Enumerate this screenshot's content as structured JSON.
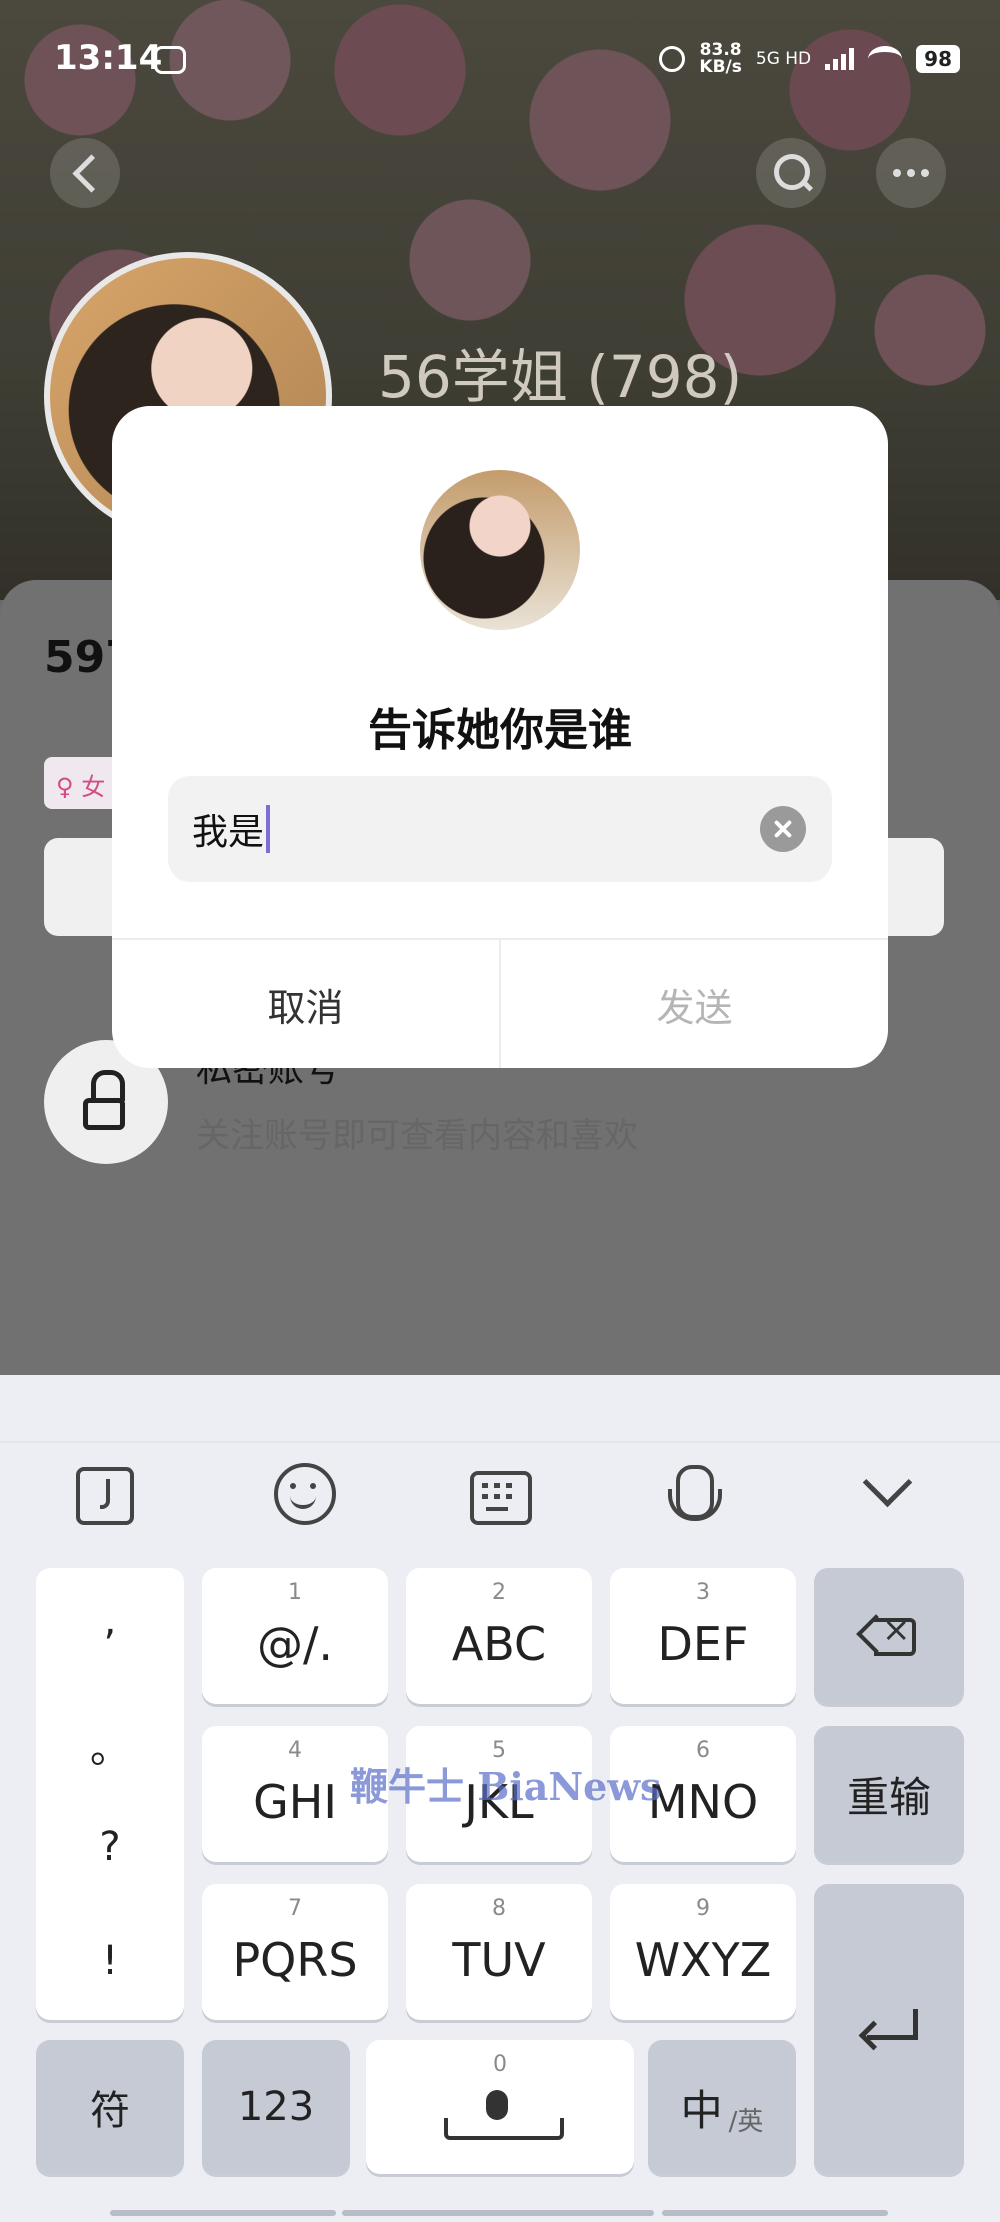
{
  "status_bar": {
    "time": "13:14",
    "net_speed_value": "83.8",
    "net_speed_unit": "KB/s",
    "network": "5G HD",
    "battery": "98"
  },
  "profile": {
    "name": "56学姐 (798)",
    "stat_partial": "597",
    "tag_partial": "♀ 女",
    "private_title": "私密账号",
    "private_subtitle": "关注账号即可查看内容和喜欢"
  },
  "dialog": {
    "title": "告诉她你是谁",
    "input_value": "我是",
    "cancel_label": "取消",
    "send_label": "发送"
  },
  "keyboard": {
    "punctuation": [
      ",",
      "。",
      "?",
      "!"
    ],
    "rows": [
      [
        {
          "num": "1",
          "label": "@/."
        },
        {
          "num": "2",
          "label": "ABC"
        },
        {
          "num": "3",
          "label": "DEF"
        }
      ],
      [
        {
          "num": "4",
          "label": "GHI"
        },
        {
          "num": "5",
          "label": "JKL"
        },
        {
          "num": "6",
          "label": "MNO"
        }
      ],
      [
        {
          "num": "7",
          "label": "PQRS"
        },
        {
          "num": "8",
          "label": "TUV"
        },
        {
          "num": "9",
          "label": "WXYZ"
        }
      ]
    ],
    "reinput_label": "重输",
    "symbols_label": "符",
    "numbers_label": "123",
    "space_num": "0",
    "lang_main": "中",
    "lang_sub": "/英"
  },
  "watermark": "鞭牛士 BiaNews"
}
